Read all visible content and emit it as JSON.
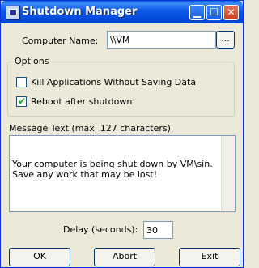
{
  "window": {
    "title": "Shutdown Manager"
  },
  "title_buttons": {
    "minimize": "▁",
    "maximize": "☐",
    "close": "✕"
  },
  "computer": {
    "label": "Computer Name:",
    "value": "\\\\VM",
    "browse_label": "..."
  },
  "options": {
    "group_label": "Options",
    "kill_apps": {
      "label": "Kill Applications Without Saving Data",
      "checked": false
    },
    "reboot": {
      "label": "Reboot after shutdown",
      "checked": true
    }
  },
  "message": {
    "label": "Message Text (max. 127 characters)",
    "text": "Your computer is being shut down by VM\\sin.  Save any work that may be lost!"
  },
  "delay": {
    "label": "Delay (seconds):",
    "value": "30"
  },
  "buttons": {
    "ok": "OK",
    "abort": "Abort",
    "exit": "Exit"
  }
}
